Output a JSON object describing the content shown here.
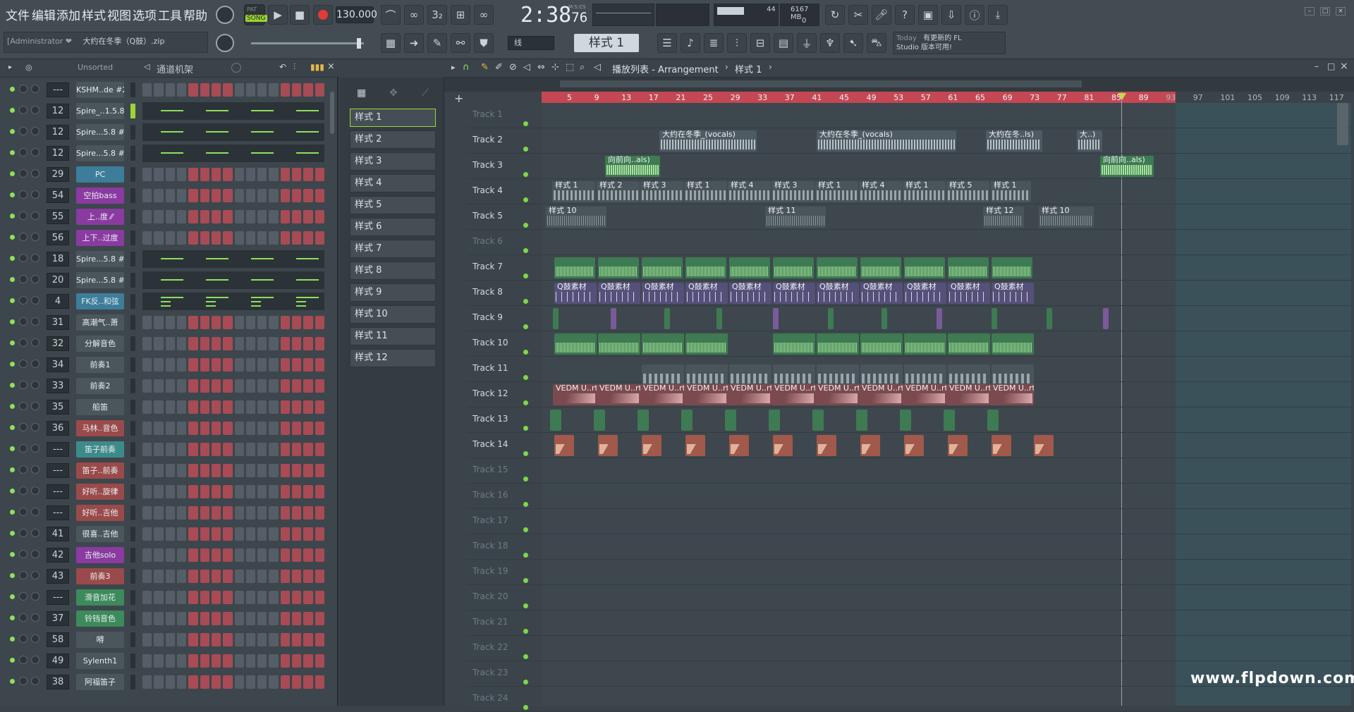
{
  "menu": [
    "文件",
    "编辑",
    "添加",
    "样式",
    "视图",
    "选项",
    "工具",
    "帮助"
  ],
  "transport": {
    "song_label": "SONG",
    "pat_label": "PAT",
    "tempo": "130.000",
    "time": "2:38",
    "time_small": "76",
    "time_unit": "M:S:CS",
    "cpu": "44",
    "mem": "6167 MB",
    "poly": "0"
  },
  "hint": {
    "user": "[Administrator ❤",
    "project": "大约在冬季（Q鼓）.zip"
  },
  "toolbar2": {
    "snap": "线",
    "pattern": "样式 1"
  },
  "news": {
    "today": "Today",
    "line1": "有更新的 FL",
    "line2": "Studio 版本可用!"
  },
  "channel_rack": {
    "filter": "Unsorted",
    "title": "通道机架"
  },
  "channels": [
    {
      "num": "---",
      "name": "KSHM..de #2",
      "color": "#4b555c",
      "type": "steps"
    },
    {
      "num": "12",
      "name": "Spire_..1.5.8",
      "color": "#4b555c",
      "type": "roll",
      "sel": true
    },
    {
      "num": "12",
      "name": "Spire...5.8 #2",
      "color": "#4b555c",
      "type": "roll"
    },
    {
      "num": "12",
      "name": "Spire...5.8 #3",
      "color": "#4b555c",
      "type": "roll"
    },
    {
      "num": "29",
      "name": "PC",
      "color": "#3d7d9a",
      "type": "steps"
    },
    {
      "num": "54",
      "name": "空拍bass",
      "color": "#8a3aa0",
      "type": "steps"
    },
    {
      "num": "55",
      "name": "上..度 ⁄⁄",
      "color": "#8a3aa0",
      "type": "steps"
    },
    {
      "num": "56",
      "name": "上下..过度",
      "color": "#8a3aa0",
      "type": "steps"
    },
    {
      "num": "18",
      "name": "Spire...5.8 #4",
      "color": "#4b555c",
      "type": "roll"
    },
    {
      "num": "20",
      "name": "Spire...5.8 #5",
      "color": "#4b555c",
      "type": "roll"
    },
    {
      "num": "4",
      "name": "FK反..和弦",
      "color": "#3d7d9a",
      "type": "roll"
    },
    {
      "num": "31",
      "name": "高潮气..萧",
      "color": "#4b555c",
      "type": "steps"
    },
    {
      "num": "32",
      "name": "分解音色",
      "color": "#4b555c",
      "type": "steps"
    },
    {
      "num": "34",
      "name": "前奏1",
      "color": "#4b555c",
      "type": "steps"
    },
    {
      "num": "33",
      "name": "前奏2",
      "color": "#4b555c",
      "type": "steps"
    },
    {
      "num": "35",
      "name": "船笛",
      "color": "#4b555c",
      "type": "steps"
    },
    {
      "num": "36",
      "name": "马林..音色",
      "color": "#9a4a4a",
      "type": "steps"
    },
    {
      "num": "---",
      "name": "笛子前奏",
      "color": "#3d8a8a",
      "type": "steps"
    },
    {
      "num": "---",
      "name": "笛子..前奏",
      "color": "#9a4a4a",
      "type": "steps"
    },
    {
      "num": "---",
      "name": "好听..旋律",
      "color": "#9a4a4a",
      "type": "steps"
    },
    {
      "num": "---",
      "name": "好听..吉他",
      "color": "#9a4a4a",
      "type": "steps"
    },
    {
      "num": "41",
      "name": "很喜..吉他",
      "color": "#4b555c",
      "type": "steps"
    },
    {
      "num": "42",
      "name": "吉他solo",
      "color": "#8a3aa0",
      "type": "steps"
    },
    {
      "num": "43",
      "name": "前奏3",
      "color": "#9a4a4a",
      "type": "steps"
    },
    {
      "num": "---",
      "name": "滑音加花",
      "color": "#3d8a5a",
      "type": "steps"
    },
    {
      "num": "37",
      "name": "铃铛音色",
      "color": "#3d8a5a",
      "type": "steps"
    },
    {
      "num": "58",
      "name": "嘚",
      "color": "#4b555c",
      "type": "steps"
    },
    {
      "num": "49",
      "name": "Sylenth1",
      "color": "#4b555c",
      "type": "steps"
    },
    {
      "num": "38",
      "name": "阿福笛子",
      "color": "#4b555c",
      "type": "steps"
    }
  ],
  "patterns": [
    "样式 1",
    "样式 2",
    "样式 3",
    "样式 4",
    "样式 5",
    "样式 6",
    "样式 7",
    "样式 8",
    "样式 9",
    "样式 10",
    "样式 11",
    "样式 12"
  ],
  "playlist": {
    "title": "播放列表 - Arrangement",
    "pattern": "样式 1"
  },
  "ruler": [
    "5",
    "9",
    "13",
    "17",
    "21",
    "25",
    "29",
    "33",
    "37",
    "41",
    "45",
    "49",
    "53",
    "57",
    "61",
    "65",
    "69",
    "73",
    "77",
    "81",
    "85",
    "89",
    "93",
    "97",
    "101",
    "105",
    "109",
    "113",
    "117"
  ],
  "tracks": [
    "Track 1",
    "Track 2",
    "Track 3",
    "Track 4",
    "Track 5",
    "Track 6",
    "Track 7",
    "Track 8",
    "Track 9",
    "Track 10",
    "Track 11",
    "Track 12",
    "Track 13",
    "Track 14",
    "Track 15",
    "Track 16",
    "Track 17",
    "Track 18",
    "Track 19",
    "Track 20",
    "Track 21",
    "Track 22",
    "Track 23",
    "Track 24"
  ],
  "clip_labels": {
    "vocals": "大约在冬季_(vocals)",
    "vocals2": "大约在冬..ls)",
    "vocals3": "大..)",
    "forward": "向前向..als)",
    "qdrum": "Q鼓素材",
    "vedm": "VEDM U..rt_1"
  },
  "track4_clips": [
    "样式 1",
    "样式 2",
    "样式 3",
    "样式 1",
    "样式 4",
    "样式 3",
    "样式 1",
    "样式 4",
    "样式 1",
    "样式 5",
    "样式 1"
  ],
  "track5_clips": [
    "样式 10",
    "样式 11",
    "样式 12",
    "样式 10"
  ],
  "watermark": "www.flpdown.com"
}
